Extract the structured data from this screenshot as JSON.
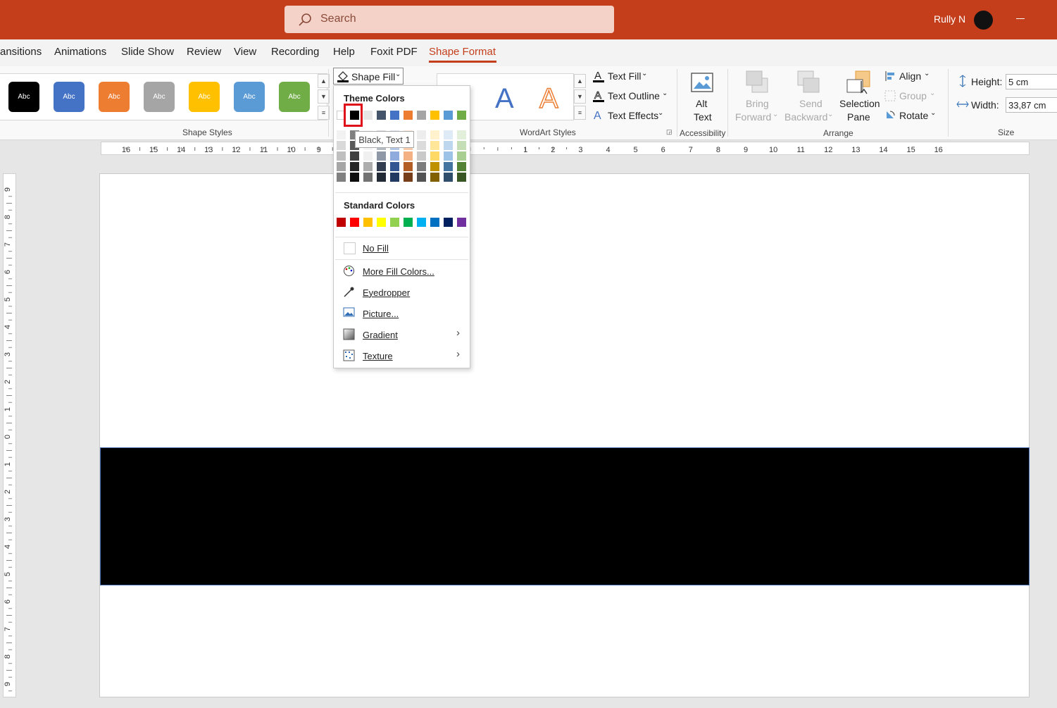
{
  "titlebar": {
    "search_placeholder": "Search",
    "user_name": "Rully N"
  },
  "tabs": [
    "ansitions",
    "Animations",
    "Slide Show",
    "Review",
    "View",
    "Recording",
    "Help",
    "Foxit PDF",
    "Shape Format"
  ],
  "active_tab": "Shape Format",
  "shape_styles": {
    "swatch_label": "Abc",
    "colors": [
      "#000000",
      "#4472c4",
      "#ed7d31",
      "#a5a5a5",
      "#ffc000",
      "#5b9bd5",
      "#70ad47"
    ],
    "group_label": "Shape Styles"
  },
  "shape_fill_button": "Shape Fill",
  "wordart": {
    "text_fill": "Text Fill",
    "text_outline": "Text Outline",
    "text_effects": "Text Effects",
    "group_label": "WordArt Styles",
    "letter": "A"
  },
  "accessibility": {
    "alt_text_line1": "Alt",
    "alt_text_line2": "Text",
    "group_label": "Accessibility"
  },
  "arrange": {
    "bring_forward_1": "Bring",
    "bring_forward_2": "Forward",
    "send_backward_1": "Send",
    "send_backward_2": "Backward",
    "selection_pane_1": "Selection",
    "selection_pane_2": "Pane",
    "align": "Align",
    "group": "Group",
    "rotate": "Rotate",
    "group_label": "Arrange"
  },
  "size": {
    "height_label": "Height:",
    "height_value": "5 cm",
    "width_label": "Width:",
    "width_value": "33,87 cm",
    "group_label": "Size"
  },
  "ruler": {
    "horizontal": [
      "16",
      "15",
      "14",
      "13",
      "12",
      "11",
      "10",
      "9",
      "1",
      "0",
      "1",
      "2",
      "3",
      "4",
      "5",
      "6",
      "7",
      "8",
      "9",
      "10",
      "11",
      "12",
      "13",
      "14",
      "15",
      "16"
    ],
    "vertical": [
      "9",
      "8",
      "7",
      "6",
      "5",
      "4",
      "3",
      "2",
      "1",
      "0",
      "1",
      "2",
      "3",
      "4",
      "5",
      "6",
      "7",
      "8",
      "9"
    ]
  },
  "fill_menu": {
    "theme_colors_heading": "Theme Colors",
    "theme_colors": [
      "#ffffff",
      "#000000",
      "#e7e6e6",
      "#44546a",
      "#4472c4",
      "#ed7d31",
      "#a5a5a5",
      "#ffc000",
      "#5b9bd5",
      "#70ad47"
    ],
    "standard_colors_heading": "Standard Colors",
    "standard_colors": [
      "#c00000",
      "#ff0000",
      "#ffc000",
      "#ffff00",
      "#92d050",
      "#00b050",
      "#00b0f0",
      "#0070c0",
      "#002060",
      "#7030a0"
    ],
    "no_fill": "No Fill",
    "more_fill_colors": "More Fill Colors...",
    "eyedropper": "Eyedropper",
    "picture": "Picture...",
    "gradient": "Gradient",
    "texture": "Texture",
    "tooltip": "Black, Text 1"
  }
}
